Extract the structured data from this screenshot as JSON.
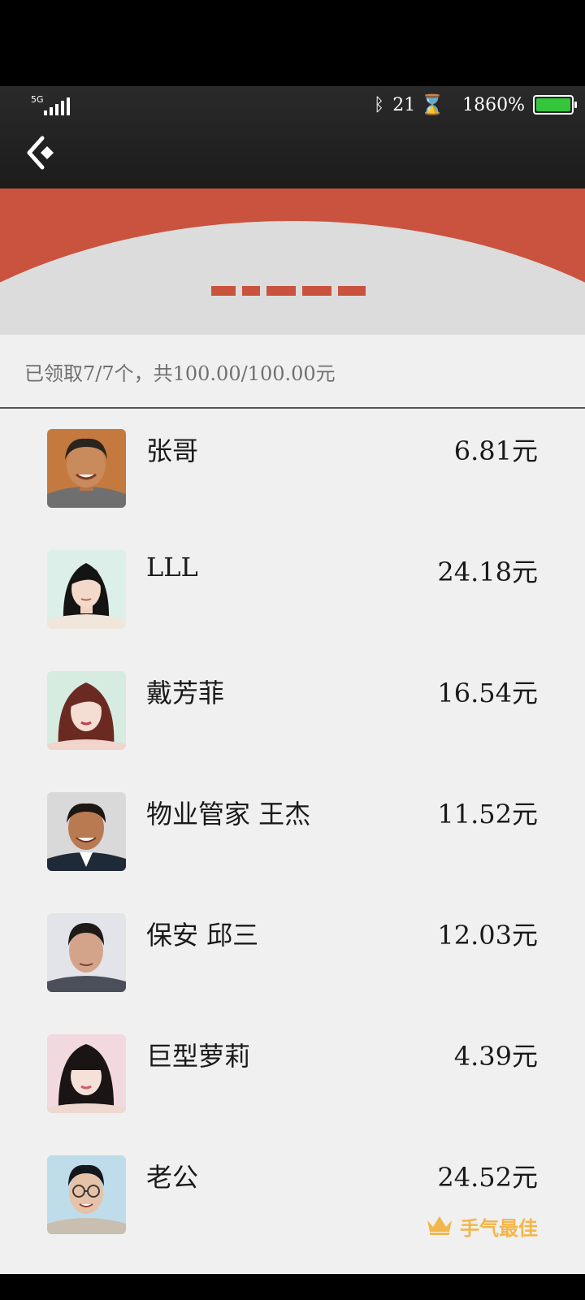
{
  "status_bar": {
    "network": "5G",
    "bluetooth_icon": "bluetooth-icon",
    "notif_count": "21",
    "hourglass_icon": "hourglass-icon",
    "battery_percent": "1860%",
    "battery_color": "#35c53c"
  },
  "header": {
    "back_icon": "back-arrow-icon"
  },
  "summary": "已领取7/7个，共100.00/100.00元",
  "accent_colors": {
    "red_band": "#c9533f",
    "best_luck": "#f3b64a"
  },
  "recipients": [
    {
      "name": "张哥",
      "amount": "6.81元"
    },
    {
      "name": "LLL",
      "amount": "24.18元"
    },
    {
      "name": "戴芳菲",
      "amount": "16.54元"
    },
    {
      "name": "物业管家 王杰",
      "amount": "11.52元"
    },
    {
      "name": "保安 邱三",
      "amount": "12.03元"
    },
    {
      "name": "巨型萝莉",
      "amount": "4.39元"
    },
    {
      "name": "老公",
      "amount": "24.52元",
      "badge": "手气最佳",
      "badge_icon": "crown-icon"
    }
  ]
}
